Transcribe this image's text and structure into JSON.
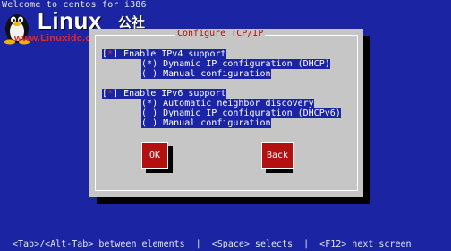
{
  "screen": {
    "top_text": "Welcome to centos for i386"
  },
  "logo": {
    "brand": "Linux",
    "brand_cn": "公社",
    "url": "www.Linuxidc.com"
  },
  "dialog": {
    "title": "Configure TCP/IP",
    "ipv4": {
      "checked_mark": "*",
      "label": "Enable IPv4 support",
      "options": [
        {
          "mark": "*",
          "label": "Dynamic IP configuration (DHCP)"
        },
        {
          "mark": " ",
          "label": "Manual configuration"
        }
      ]
    },
    "ipv6": {
      "checked_mark": "*",
      "label": "Enable IPv6 support",
      "options": [
        {
          "mark": "*",
          "label": "Automatic neighbor discovery"
        },
        {
          "mark": " ",
          "label": "Dynamic IP configuration (DHCPv6)"
        },
        {
          "mark": " ",
          "label": "Manual configuration"
        }
      ]
    },
    "buttons": {
      "ok": "OK",
      "back": "Back"
    }
  },
  "help_bar": "<Tab>/<Alt-Tab> between elements  |  <Space> selects  |  <F12> next screen"
}
